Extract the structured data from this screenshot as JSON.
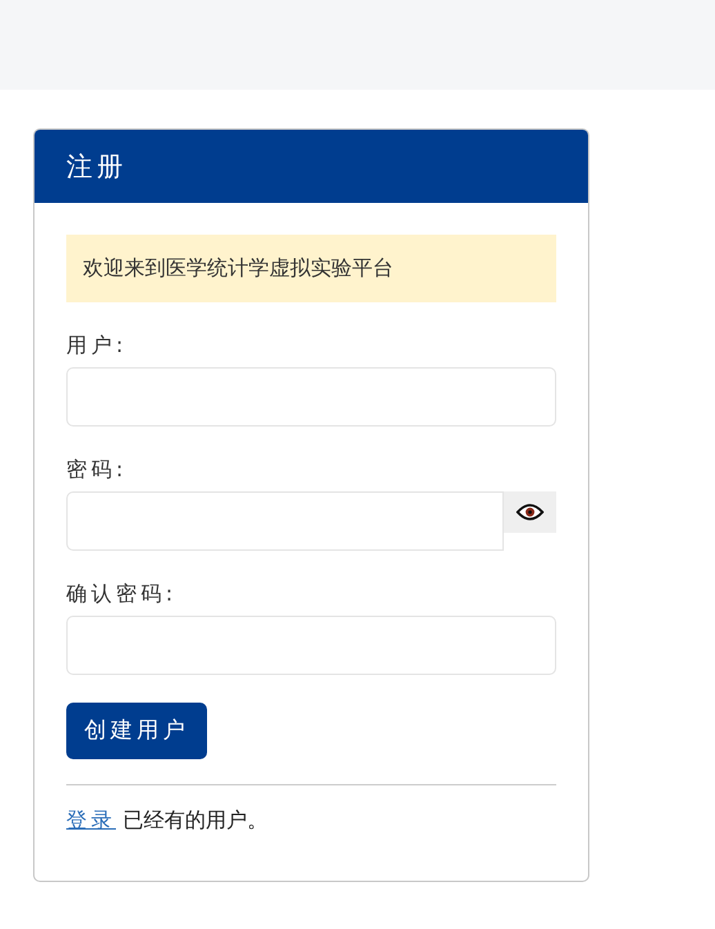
{
  "card": {
    "title": "注册"
  },
  "notice": "欢迎来到医学统计学虚拟实验平台",
  "fields": [
    {
      "label": "用户:",
      "kind": "text"
    },
    {
      "label": "密码:",
      "kind": "password"
    },
    {
      "label": "确认密码:",
      "kind": "text"
    }
  ],
  "submit_button": "创建用户",
  "footer": {
    "link": "登录",
    "text": "已经有的用户。"
  }
}
